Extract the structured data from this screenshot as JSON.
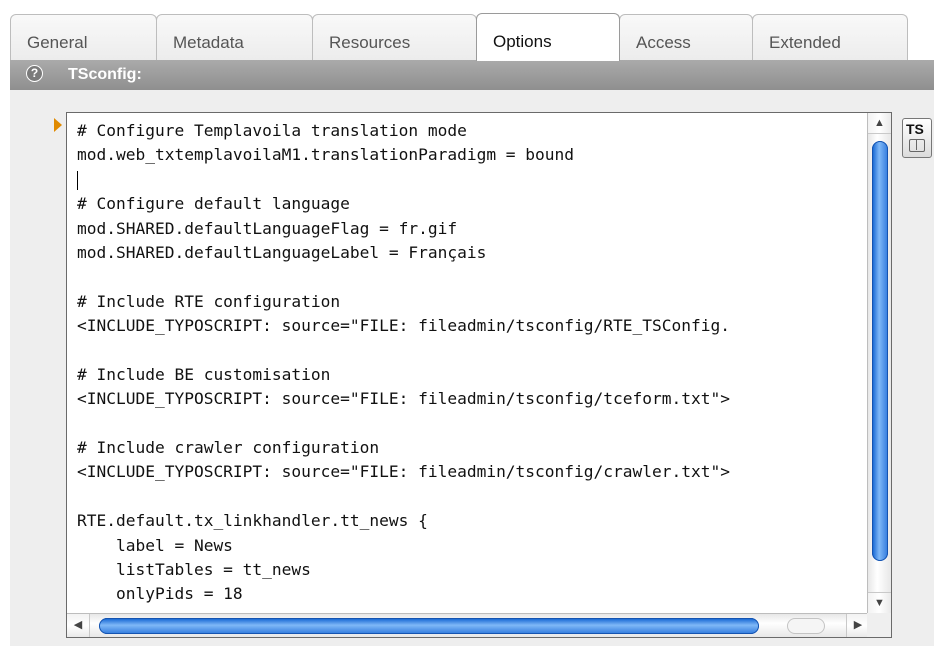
{
  "tabs": [
    {
      "label": "General",
      "active": false
    },
    {
      "label": "Metadata",
      "active": false
    },
    {
      "label": "Resources",
      "active": false
    },
    {
      "label": "Options",
      "active": true
    },
    {
      "label": "Access",
      "active": false
    },
    {
      "label": "Extended",
      "active": false
    }
  ],
  "section": {
    "help_glyph": "?",
    "title": "TSconfig:"
  },
  "editor": {
    "lines": [
      "# Configure Templavoila translation mode",
      "mod.web_txtemplavoilaM1.translationParadigm = bound",
      "",
      "# Configure default language",
      "mod.SHARED.defaultLanguageFlag = fr.gif",
      "mod.SHARED.defaultLanguageLabel = Français",
      "",
      "# Include RTE configuration",
      "<INCLUDE_TYPOSCRIPT: source=\"FILE: fileadmin/tsconfig/RTE_TSConfig.",
      "",
      "# Include BE customisation",
      "<INCLUDE_TYPOSCRIPT: source=\"FILE: fileadmin/tsconfig/tceform.txt\">",
      "",
      "# Include crawler configuration",
      "<INCLUDE_TYPOSCRIPT: source=\"FILE: fileadmin/tsconfig/crawler.txt\">",
      "",
      "RTE.default.tx_linkhandler.tt_news {",
      "    label = News",
      "    listTables = tt_news",
      "    onlyPids = 18"
    ],
    "caret_line": 2
  },
  "ts_wizard": {
    "label": "TS",
    "icon": "ts-wizard-icon"
  },
  "colors": {
    "accent_scroll": "#2f79dd",
    "section_bar": "#999999",
    "marker": "#e08a00"
  }
}
